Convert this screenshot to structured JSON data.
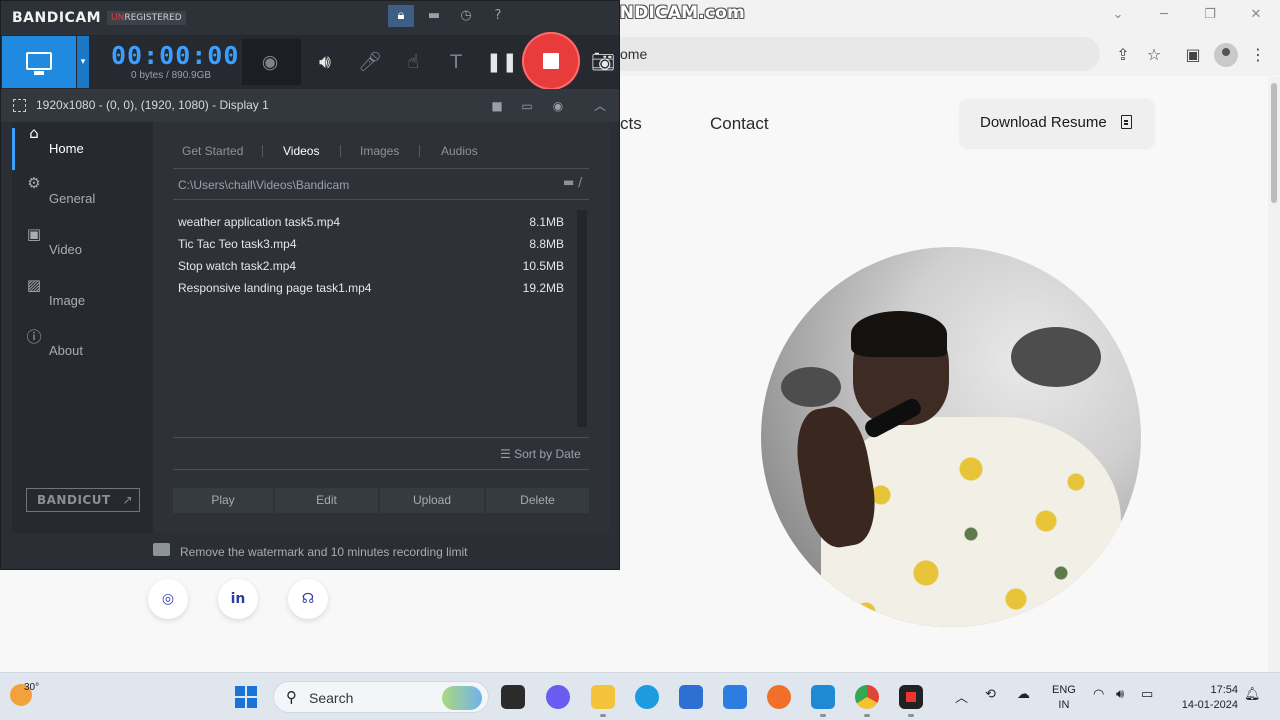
{
  "browser": {
    "watermark": "www.BANDICAM.com",
    "address_partial": "ome",
    "nav": {
      "projects_partial": "cts",
      "contact": "Contact"
    },
    "resume_button": "Download Resume"
  },
  "bandicam": {
    "logo": "BANDICAM",
    "unregistered_prefix": "UN",
    "unregistered_rest": "REGISTERED",
    "timer": "00:00:00",
    "storage": "0 bytes / 890.9GB",
    "region": "1920x1080 - (0, 0), (1920, 1080) - Display 1",
    "sidebar": {
      "items": [
        {
          "label": "Home",
          "icon": "home-icon",
          "active": true
        },
        {
          "label": "General",
          "icon": "gear-icon",
          "active": false
        },
        {
          "label": "Video",
          "icon": "video-icon",
          "active": false
        },
        {
          "label": "Image",
          "icon": "image-icon",
          "active": false
        },
        {
          "label": "About",
          "icon": "info-icon",
          "active": false
        }
      ],
      "bandicut": "BANDICUT"
    },
    "tabs": [
      "Get Started",
      "Videos",
      "Images",
      "Audios"
    ],
    "active_tab": "Videos",
    "path": "C:\\Users\\chall\\Videos\\Bandicam",
    "files": [
      {
        "name": "weather application task5.mp4",
        "size": "8.1MB"
      },
      {
        "name": "Tic Tac Teo task3.mp4",
        "size": "8.8MB"
      },
      {
        "name": "Stop watch task2.mp4",
        "size": "10.5MB"
      },
      {
        "name": "Responsive landing page task1.mp4",
        "size": "19.2MB"
      }
    ],
    "sort_label": "Sort by Date",
    "actions": [
      "Play",
      "Edit",
      "Upload",
      "Delete"
    ],
    "footer_text": "Remove the watermark and 10 minutes recording limit"
  },
  "taskbar": {
    "weather": "30°",
    "search_label": "Search",
    "lang_top": "ENG",
    "lang_bottom": "IN",
    "time": "17:54",
    "date": "14-01-2024"
  },
  "colors": {
    "accent_blue": "#1f8ae0",
    "timer_blue": "#3aa0ff",
    "record_red": "#e83b3b"
  }
}
